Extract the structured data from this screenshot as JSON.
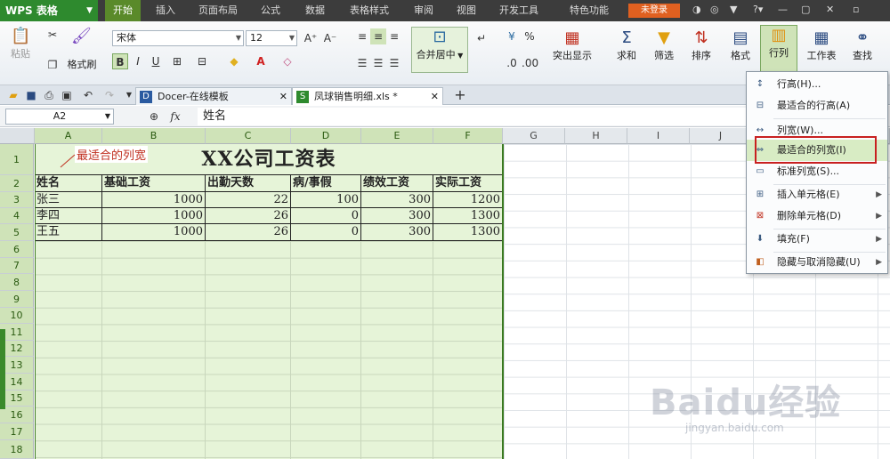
{
  "app": {
    "name": "WPS 表格"
  },
  "menu": {
    "tabs": [
      "开始",
      "插入",
      "页面布局",
      "公式",
      "数据",
      "表格样式",
      "审阅",
      "视图",
      "开发工具",
      "特色功能"
    ],
    "active": "开始",
    "login": "未登录"
  },
  "ribbon": {
    "paste": "粘贴",
    "format_painter": "格式刷",
    "font_name": "宋体",
    "font_size": "12",
    "merge_center": "合并居中",
    "highlight": "突出显示",
    "sum": "求和",
    "filter": "筛选",
    "sort": "排序",
    "format": "格式",
    "rows_cols": "行列",
    "worksheet": "工作表",
    "find": "查找",
    "bold": "B",
    "italic": "I",
    "underline": "U",
    "percent": "%"
  },
  "tabs": [
    {
      "label": "Docer-在线模板"
    },
    {
      "label": "凤球销售明细.xls *"
    }
  ],
  "formula_bar": {
    "cell_ref": "A2",
    "fx": "fx",
    "value": "姓名"
  },
  "sheet": {
    "columns": [
      "A",
      "B",
      "C",
      "D",
      "E",
      "F",
      "G",
      "H",
      "I",
      "J"
    ],
    "rows": [
      "1",
      "2",
      "3",
      "4",
      "5",
      "6",
      "7",
      "8",
      "9",
      "10",
      "11",
      "12",
      "13",
      "14",
      "15",
      "16",
      "17",
      "18"
    ],
    "title": "XX公司工资表",
    "headers": [
      "姓名",
      "基础工资",
      "出勤天数",
      "病/事假",
      "绩效工资",
      "实际工资"
    ],
    "data": [
      [
        "张三",
        "1000",
        "22",
        "100",
        "300",
        "1200"
      ],
      [
        "李四",
        "1000",
        "26",
        "0",
        "300",
        "1300"
      ],
      [
        "王五",
        "1000",
        "26",
        "0",
        "300",
        "1300"
      ]
    ]
  },
  "annotation": "最适合的列宽",
  "context_menu": {
    "items": [
      {
        "label": "行高(H)...",
        "icon": "row-height-icon",
        "submenu": false
      },
      {
        "label": "最适合的行高(A)",
        "icon": "autofit-row-icon",
        "submenu": false
      },
      {
        "label": "列宽(W)...",
        "icon": "column-width-icon",
        "submenu": false
      },
      {
        "label": "最适合的列宽(I)",
        "icon": "autofit-column-icon",
        "submenu": false,
        "highlighted": true
      },
      {
        "label": "标准列宽(S)...",
        "icon": "standard-width-icon",
        "submenu": false
      },
      {
        "label": "插入单元格(E)",
        "icon": "insert-cells-icon",
        "submenu": true
      },
      {
        "label": "删除单元格(D)",
        "icon": "delete-cells-icon",
        "submenu": true
      },
      {
        "label": "填充(F)",
        "icon": "fill-icon",
        "submenu": true
      },
      {
        "label": "隐藏与取消隐藏(U)",
        "icon": "hide-unhide-icon",
        "submenu": true
      }
    ]
  },
  "watermark": {
    "main": "Baidu经验",
    "sub": "jingyan.baidu.com"
  },
  "colors": {
    "accent": "#2e8a2e",
    "selection": "#e6f4d8",
    "highlight_box": "#c82020",
    "login": "#e06020"
  }
}
